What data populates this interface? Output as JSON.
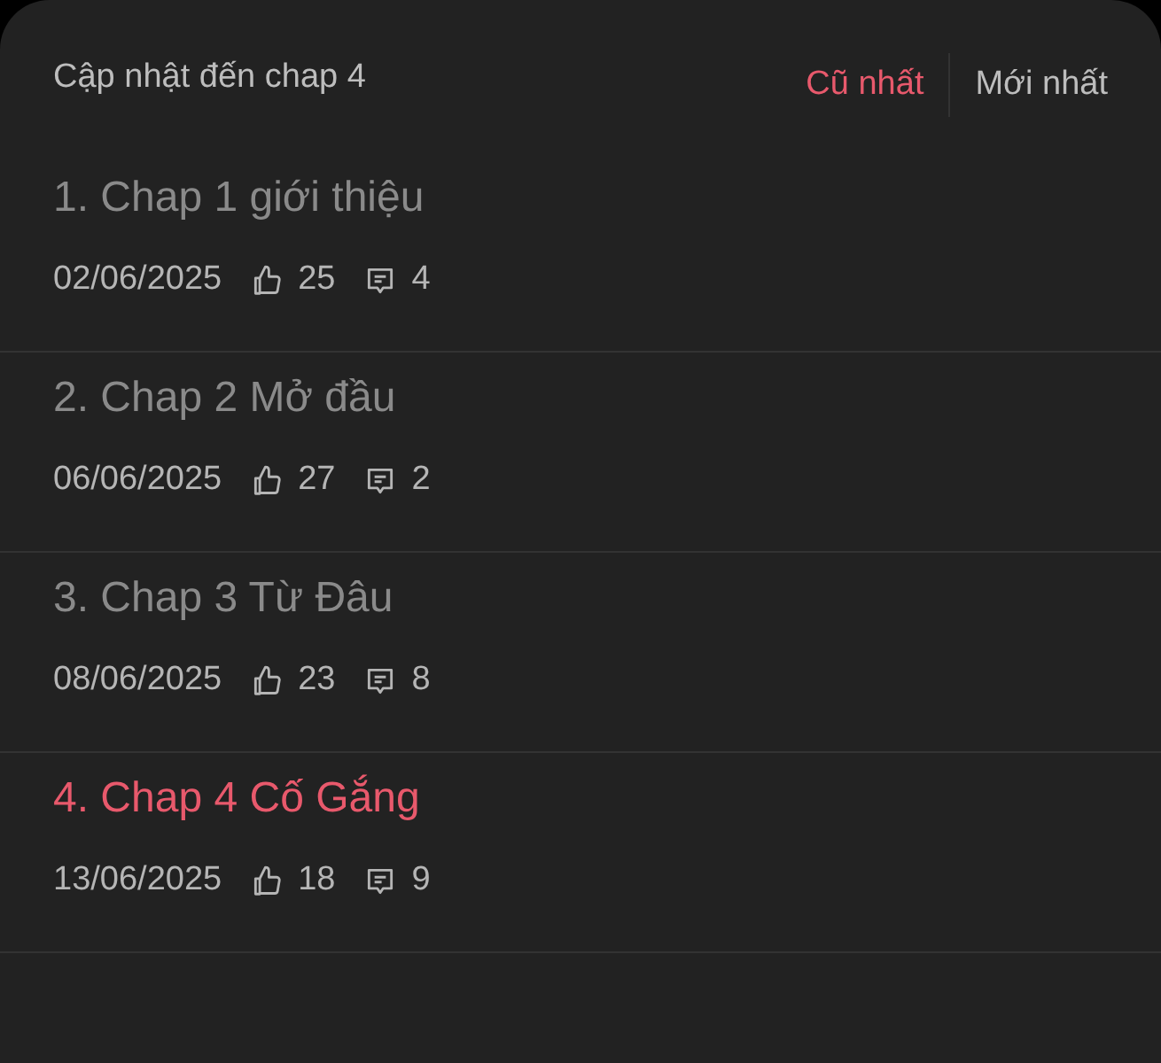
{
  "header": {
    "title": "Cập nhật đến chap 4",
    "sort_options": [
      {
        "label": "Cũ nhất",
        "selected": true
      },
      {
        "label": "Mới nhất",
        "selected": false
      }
    ]
  },
  "chapters": [
    {
      "title": "1. Chap 1 giới thiệu",
      "date": "02/06/2025",
      "likes": "25",
      "comments": "4",
      "selected": false
    },
    {
      "title": "2. Chap 2 Mở đầu",
      "date": "06/06/2025",
      "likes": "27",
      "comments": "2",
      "selected": false
    },
    {
      "title": "3. Chap 3 Từ Đâu",
      "date": "08/06/2025",
      "likes": "23",
      "comments": "8",
      "selected": false
    },
    {
      "title": "4. Chap 4 Cố Gắng",
      "date": "13/06/2025",
      "likes": "18",
      "comments": "9",
      "selected": true
    }
  ]
}
